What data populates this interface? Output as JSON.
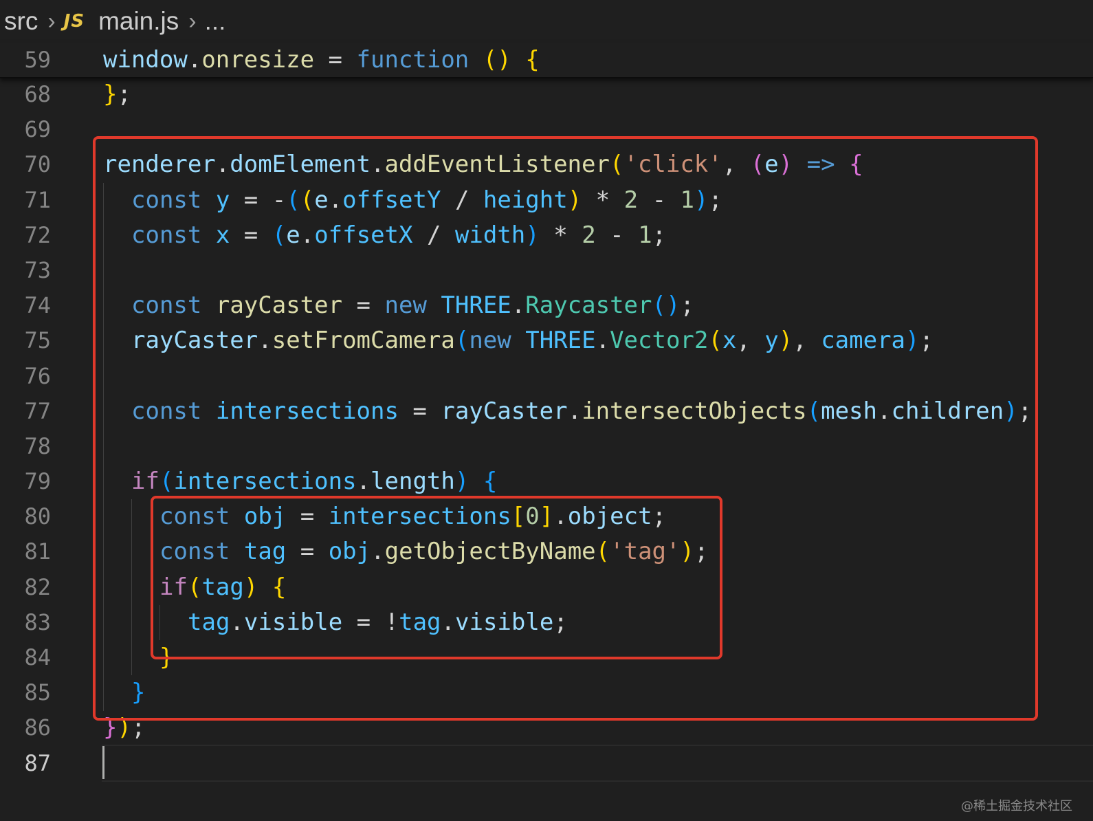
{
  "breadcrumb": {
    "folder": "src",
    "file_icon": "JS",
    "file": "main.js",
    "more": "..."
  },
  "sticky": {
    "line_number": "59",
    "tokens": [
      {
        "t": "window",
        "c": "#9cdcfe"
      },
      {
        "t": ".",
        "c": "#d4d4d4"
      },
      {
        "t": "onresize",
        "c": "#dcdcaa"
      },
      {
        "t": " = ",
        "c": "#d4d4d4"
      },
      {
        "t": "function",
        "c": "#569cd6"
      },
      {
        "t": " ",
        "c": "#d4d4d4"
      },
      {
        "t": "()",
        "c": "#ffd700"
      },
      {
        "t": " ",
        "c": "#d4d4d4"
      },
      {
        "t": "{",
        "c": "#ffd700"
      }
    ]
  },
  "lines": [
    {
      "n": "68",
      "indent": 0,
      "tokens": [
        {
          "t": "}",
          "c": "#ffd700"
        },
        {
          "t": ";",
          "c": "#d4d4d4"
        }
      ]
    },
    {
      "n": "69",
      "indent": 0,
      "tokens": []
    },
    {
      "n": "70",
      "indent": 0,
      "tokens": [
        {
          "t": "renderer",
          "c": "#9cdcfe"
        },
        {
          "t": ".",
          "c": "#d4d4d4"
        },
        {
          "t": "domElement",
          "c": "#9cdcfe"
        },
        {
          "t": ".",
          "c": "#d4d4d4"
        },
        {
          "t": "addEventListener",
          "c": "#dcdcaa"
        },
        {
          "t": "(",
          "c": "#ffd700"
        },
        {
          "t": "'click'",
          "c": "#ce9178"
        },
        {
          "t": ", ",
          "c": "#d4d4d4"
        },
        {
          "t": "(",
          "c": "#da70d6"
        },
        {
          "t": "e",
          "c": "#9cdcfe"
        },
        {
          "t": ")",
          "c": "#da70d6"
        },
        {
          "t": " ",
          "c": "#d4d4d4"
        },
        {
          "t": "=>",
          "c": "#569cd6"
        },
        {
          "t": " ",
          "c": "#d4d4d4"
        },
        {
          "t": "{",
          "c": "#da70d6"
        }
      ]
    },
    {
      "n": "71",
      "indent": 1,
      "tokens": [
        {
          "t": "const",
          "c": "#569cd6"
        },
        {
          "t": " ",
          "c": "#d4d4d4"
        },
        {
          "t": "y",
          "c": "#4fc1ff"
        },
        {
          "t": " = ",
          "c": "#d4d4d4"
        },
        {
          "t": "-",
          "c": "#d4d4d4"
        },
        {
          "t": "(",
          "c": "#179fff"
        },
        {
          "t": "(",
          "c": "#ffd700"
        },
        {
          "t": "e",
          "c": "#9cdcfe"
        },
        {
          "t": ".",
          "c": "#d4d4d4"
        },
        {
          "t": "offsetY",
          "c": "#4fc1ff"
        },
        {
          "t": " / ",
          "c": "#d4d4d4"
        },
        {
          "t": "height",
          "c": "#4fc1ff"
        },
        {
          "t": ")",
          "c": "#ffd700"
        },
        {
          "t": " * ",
          "c": "#d4d4d4"
        },
        {
          "t": "2",
          "c": "#b5cea8"
        },
        {
          "t": " - ",
          "c": "#d4d4d4"
        },
        {
          "t": "1",
          "c": "#b5cea8"
        },
        {
          "t": ")",
          "c": "#179fff"
        },
        {
          "t": ";",
          "c": "#d4d4d4"
        }
      ]
    },
    {
      "n": "72",
      "indent": 1,
      "tokens": [
        {
          "t": "const",
          "c": "#569cd6"
        },
        {
          "t": " ",
          "c": "#d4d4d4"
        },
        {
          "t": "x",
          "c": "#4fc1ff"
        },
        {
          "t": " = ",
          "c": "#d4d4d4"
        },
        {
          "t": "(",
          "c": "#179fff"
        },
        {
          "t": "e",
          "c": "#9cdcfe"
        },
        {
          "t": ".",
          "c": "#d4d4d4"
        },
        {
          "t": "offsetX",
          "c": "#4fc1ff"
        },
        {
          "t": " / ",
          "c": "#d4d4d4"
        },
        {
          "t": "width",
          "c": "#4fc1ff"
        },
        {
          "t": ")",
          "c": "#179fff"
        },
        {
          "t": " * ",
          "c": "#d4d4d4"
        },
        {
          "t": "2",
          "c": "#b5cea8"
        },
        {
          "t": " - ",
          "c": "#d4d4d4"
        },
        {
          "t": "1",
          "c": "#b5cea8"
        },
        {
          "t": ";",
          "c": "#d4d4d4"
        }
      ]
    },
    {
      "n": "73",
      "indent": 1,
      "tokens": []
    },
    {
      "n": "74",
      "indent": 1,
      "tokens": [
        {
          "t": "const",
          "c": "#569cd6"
        },
        {
          "t": " ",
          "c": "#d4d4d4"
        },
        {
          "t": "rayCaster",
          "c": "#dcdcaa"
        },
        {
          "t": " = ",
          "c": "#d4d4d4"
        },
        {
          "t": "new",
          "c": "#569cd6"
        },
        {
          "t": " ",
          "c": "#d4d4d4"
        },
        {
          "t": "THREE",
          "c": "#4fc1ff"
        },
        {
          "t": ".",
          "c": "#d4d4d4"
        },
        {
          "t": "Raycaster",
          "c": "#4ec9b0"
        },
        {
          "t": "()",
          "c": "#179fff"
        },
        {
          "t": ";",
          "c": "#d4d4d4"
        }
      ]
    },
    {
      "n": "75",
      "indent": 1,
      "tokens": [
        {
          "t": "rayCaster",
          "c": "#9cdcfe"
        },
        {
          "t": ".",
          "c": "#d4d4d4"
        },
        {
          "t": "setFromCamera",
          "c": "#dcdcaa"
        },
        {
          "t": "(",
          "c": "#179fff"
        },
        {
          "t": "new",
          "c": "#569cd6"
        },
        {
          "t": " ",
          "c": "#d4d4d4"
        },
        {
          "t": "THREE",
          "c": "#4fc1ff"
        },
        {
          "t": ".",
          "c": "#d4d4d4"
        },
        {
          "t": "Vector2",
          "c": "#4ec9b0"
        },
        {
          "t": "(",
          "c": "#ffd700"
        },
        {
          "t": "x",
          "c": "#4fc1ff"
        },
        {
          "t": ", ",
          "c": "#d4d4d4"
        },
        {
          "t": "y",
          "c": "#4fc1ff"
        },
        {
          "t": ")",
          "c": "#ffd700"
        },
        {
          "t": ", ",
          "c": "#d4d4d4"
        },
        {
          "t": "camera",
          "c": "#4fc1ff"
        },
        {
          "t": ")",
          "c": "#179fff"
        },
        {
          "t": ";",
          "c": "#d4d4d4"
        }
      ]
    },
    {
      "n": "76",
      "indent": 1,
      "tokens": []
    },
    {
      "n": "77",
      "indent": 1,
      "tokens": [
        {
          "t": "const",
          "c": "#569cd6"
        },
        {
          "t": " ",
          "c": "#d4d4d4"
        },
        {
          "t": "intersections",
          "c": "#4fc1ff"
        },
        {
          "t": " = ",
          "c": "#d4d4d4"
        },
        {
          "t": "rayCaster",
          "c": "#9cdcfe"
        },
        {
          "t": ".",
          "c": "#d4d4d4"
        },
        {
          "t": "intersectObjects",
          "c": "#dcdcaa"
        },
        {
          "t": "(",
          "c": "#179fff"
        },
        {
          "t": "mesh",
          "c": "#9cdcfe"
        },
        {
          "t": ".",
          "c": "#d4d4d4"
        },
        {
          "t": "children",
          "c": "#9cdcfe"
        },
        {
          "t": ")",
          "c": "#179fff"
        },
        {
          "t": ";",
          "c": "#d4d4d4"
        }
      ]
    },
    {
      "n": "78",
      "indent": 1,
      "tokens": []
    },
    {
      "n": "79",
      "indent": 1,
      "tokens": [
        {
          "t": "if",
          "c": "#c586c0"
        },
        {
          "t": "(",
          "c": "#179fff"
        },
        {
          "t": "intersections",
          "c": "#4fc1ff"
        },
        {
          "t": ".",
          "c": "#d4d4d4"
        },
        {
          "t": "length",
          "c": "#9cdcfe"
        },
        {
          "t": ")",
          "c": "#179fff"
        },
        {
          "t": " ",
          "c": "#d4d4d4"
        },
        {
          "t": "{",
          "c": "#179fff"
        }
      ]
    },
    {
      "n": "80",
      "indent": 2,
      "tokens": [
        {
          "t": "const",
          "c": "#569cd6"
        },
        {
          "t": " ",
          "c": "#d4d4d4"
        },
        {
          "t": "obj",
          "c": "#4fc1ff"
        },
        {
          "t": " = ",
          "c": "#d4d4d4"
        },
        {
          "t": "intersections",
          "c": "#4fc1ff"
        },
        {
          "t": "[",
          "c": "#ffd700"
        },
        {
          "t": "0",
          "c": "#b5cea8"
        },
        {
          "t": "]",
          "c": "#ffd700"
        },
        {
          "t": ".",
          "c": "#d4d4d4"
        },
        {
          "t": "object",
          "c": "#9cdcfe"
        },
        {
          "t": ";",
          "c": "#d4d4d4"
        }
      ]
    },
    {
      "n": "81",
      "indent": 2,
      "tokens": [
        {
          "t": "const",
          "c": "#569cd6"
        },
        {
          "t": " ",
          "c": "#d4d4d4"
        },
        {
          "t": "tag",
          "c": "#4fc1ff"
        },
        {
          "t": " = ",
          "c": "#d4d4d4"
        },
        {
          "t": "obj",
          "c": "#4fc1ff"
        },
        {
          "t": ".",
          "c": "#d4d4d4"
        },
        {
          "t": "getObjectByName",
          "c": "#dcdcaa"
        },
        {
          "t": "(",
          "c": "#ffd700"
        },
        {
          "t": "'tag'",
          "c": "#ce9178"
        },
        {
          "t": ")",
          "c": "#ffd700"
        },
        {
          "t": ";",
          "c": "#d4d4d4"
        }
      ]
    },
    {
      "n": "82",
      "indent": 2,
      "tokens": [
        {
          "t": "if",
          "c": "#c586c0"
        },
        {
          "t": "(",
          "c": "#ffd700"
        },
        {
          "t": "tag",
          "c": "#4fc1ff"
        },
        {
          "t": ")",
          "c": "#ffd700"
        },
        {
          "t": " ",
          "c": "#d4d4d4"
        },
        {
          "t": "{",
          "c": "#ffd700"
        }
      ]
    },
    {
      "n": "83",
      "indent": 3,
      "tokens": [
        {
          "t": "tag",
          "c": "#4fc1ff"
        },
        {
          "t": ".",
          "c": "#d4d4d4"
        },
        {
          "t": "visible",
          "c": "#9cdcfe"
        },
        {
          "t": " = ",
          "c": "#d4d4d4"
        },
        {
          "t": "!",
          "c": "#d4d4d4"
        },
        {
          "t": "tag",
          "c": "#4fc1ff"
        },
        {
          "t": ".",
          "c": "#d4d4d4"
        },
        {
          "t": "visible",
          "c": "#9cdcfe"
        },
        {
          "t": ";",
          "c": "#d4d4d4"
        }
      ]
    },
    {
      "n": "84",
      "indent": 2,
      "tokens": [
        {
          "t": "}",
          "c": "#ffd700"
        }
      ]
    },
    {
      "n": "85",
      "indent": 1,
      "tokens": [
        {
          "t": "}",
          "c": "#179fff"
        }
      ]
    },
    {
      "n": "86",
      "indent": 0,
      "tokens": [
        {
          "t": "}",
          "c": "#da70d6"
        },
        {
          "t": ")",
          "c": "#ffd700"
        },
        {
          "t": ";",
          "c": "#d4d4d4"
        }
      ]
    },
    {
      "n": "87",
      "indent": 0,
      "active": true,
      "tokens": []
    }
  ],
  "watermark": "@稀土掘金技术社区",
  "highlight_color": "#e0392b"
}
